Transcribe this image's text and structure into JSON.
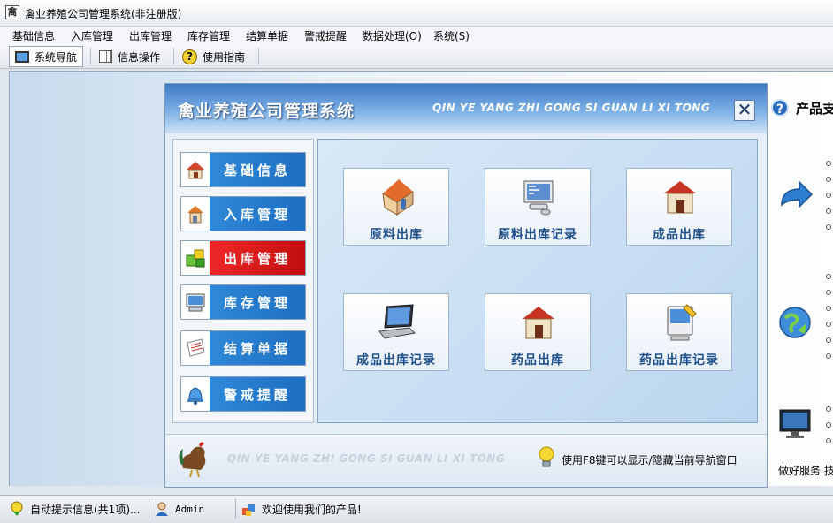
{
  "window": {
    "title": "禽业养殖公司管理系统(非注册版)"
  },
  "menubar": [
    "基础信息",
    "入库管理",
    "出库管理",
    "库存管理",
    "结算单据",
    "警戒提醒",
    "数据处理(O)",
    "系统(S)"
  ],
  "toolbar": [
    {
      "label": "系统导航",
      "icon": "monitor-icon",
      "active": true
    },
    {
      "label": "信息操作",
      "icon": "grid-icon",
      "active": false
    },
    {
      "label": "使用指南",
      "icon": "help-icon",
      "active": false
    }
  ],
  "nav": {
    "title": "禽业养殖公司管理系统",
    "subtitle": "QIN YE YANG ZHI GONG SI GUAN LI XI TONG",
    "footer_subtitle": "QIN YE YANG ZHI GONG SI GUAN LI XI TONG",
    "tip": "使用F8键可以显示/隐藏当前导航窗口",
    "menu": [
      {
        "label": "基础信息",
        "icon": "house-icon",
        "active": false
      },
      {
        "label": "入库管理",
        "icon": "house-in-icon",
        "active": false
      },
      {
        "label": "出库管理",
        "icon": "cubes-icon",
        "active": true
      },
      {
        "label": "库存管理",
        "icon": "computer-icon",
        "active": false
      },
      {
        "label": "结算单据",
        "icon": "document-icon",
        "active": false
      },
      {
        "label": "警戒提醒",
        "icon": "bell-icon",
        "active": false
      }
    ],
    "tiles": [
      {
        "label": "原料出库",
        "icon": "house-out-icon"
      },
      {
        "label": "原料出库记录",
        "icon": "monitor-record-icon"
      },
      {
        "label": "成品出库",
        "icon": "house-icon"
      },
      {
        "label": "成品出库记录",
        "icon": "laptop-icon"
      },
      {
        "label": "药品出库",
        "icon": "house-icon"
      },
      {
        "label": "药品出库记录",
        "icon": "mac-pencil-icon"
      }
    ]
  },
  "right_panel": {
    "title": "产品支",
    "footer": "做好服务  技"
  },
  "statusbar": {
    "hint": "自动提示信息(共1项)...",
    "user": "Admin",
    "welcome": "欢迎使用我们的产品!"
  },
  "colors": {
    "accent_blue": "#1e6ec2",
    "active_red": "#d81616"
  }
}
